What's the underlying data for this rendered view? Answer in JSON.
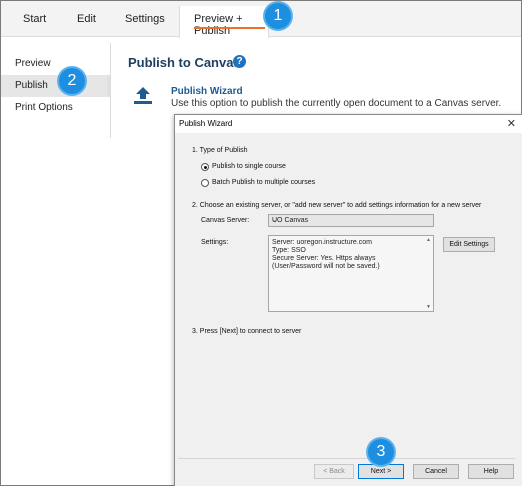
{
  "tabs": [
    "Start",
    "Edit",
    "Settings"
  ],
  "active_tab": "Preview + Publish",
  "badges": {
    "one": "1",
    "two": "2",
    "three": "3"
  },
  "nav": {
    "items": [
      "Preview",
      "Publish",
      "Print Options"
    ]
  },
  "content": {
    "title": "Publish to Canvas",
    "help": "?",
    "wizard_link": "Publish Wizard",
    "wizard_desc": "Use this option to publish the currently open document to a Canvas server."
  },
  "dialog": {
    "title": "Publish Wizard",
    "close": "✕",
    "step1": "1.  Type of Publish",
    "radio_single": "Publish to single course",
    "radio_batch": "Batch Publish to multiple courses",
    "step2": "2.  Choose an existing server, or \"add new server\" to add settings information for a new server",
    "canvas_server_label": "Canvas Server:",
    "canvas_server_value": "UO Canvas",
    "settings_label": "Settings:",
    "settings_lines": [
      "Server: uoregon.instructure.com",
      "Type: SSO",
      "Secure Server: Yes. Https always",
      "(User/Password will not be saved.)"
    ],
    "edit_settings": "Edit Settings",
    "step3": "3.  Press [Next] to connect to server",
    "buttons": {
      "back": "< Back",
      "next": "Next >",
      "cancel": "Cancel",
      "help": "Help"
    }
  },
  "colors": {
    "accent_orange": "#e8732a",
    "badge_blue": "#1e8fe0",
    "title_navy": "#1f3f60"
  }
}
